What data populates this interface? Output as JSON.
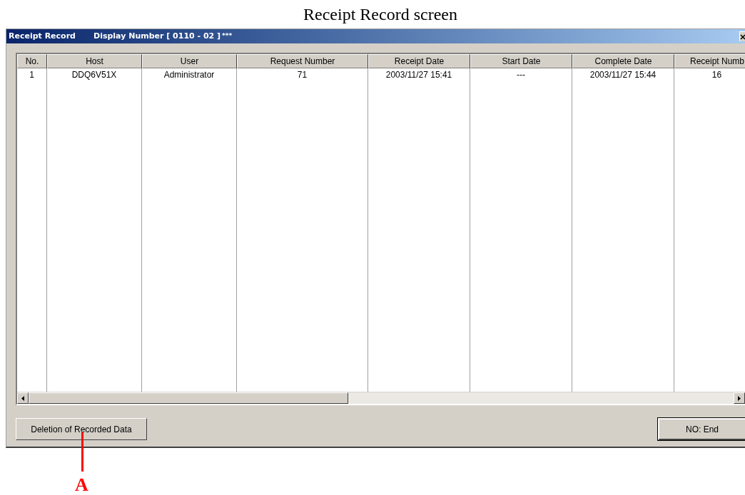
{
  "caption": "Receipt Record screen",
  "window": {
    "title": "Receipt Record",
    "display_number": "Display Number [ 0110 - 02 ]",
    "marker": "***"
  },
  "table": {
    "columns": [
      "No.",
      "Host",
      "User",
      "Request Number",
      "Receipt Date",
      "Start Date",
      "Complete Date",
      "Receipt Numb"
    ],
    "rows": [
      [
        "1",
        "DDQ6V51X",
        "Administrator",
        "71",
        "2003/11/27 15:41",
        "---",
        "2003/11/27 15:44",
        "16"
      ]
    ]
  },
  "buttons": [
    {
      "label": "Deletion of Recorded Data",
      "kind": "left"
    },
    {
      "label": "NO: End",
      "kind": "right"
    }
  ],
  "annotation": {
    "label": "A"
  }
}
